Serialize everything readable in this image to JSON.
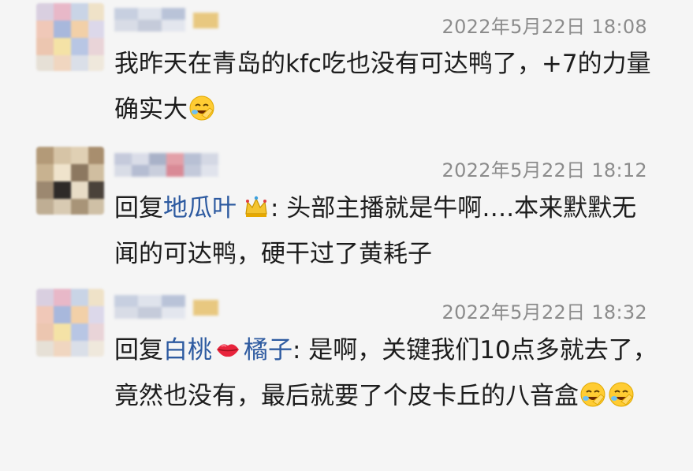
{
  "comments": [
    {
      "timestamp": "2022年5月22日 18:08",
      "text": "我昨天在青岛的kfc吃也没有可达鸭了，+7的力量确实大",
      "emoji_after": "facepalm-laugh-emoji"
    },
    {
      "timestamp": "2022年5月22日 18:12",
      "reply_prefix": "回复",
      "reply_to": "地瓜叶",
      "badge_icon": "crown-icon",
      "text": ": 头部主播就是牛啊….本来默默无闻的可达鸭，硬干过了黄耗子"
    },
    {
      "timestamp": "2022年5月22日 18:32",
      "reply_prefix": "回复",
      "reply_to_part1": "白桃",
      "name_emoji": "lips-icon",
      "reply_to_part2": "橘子",
      "text": ": 是啊，关键我们10点多就去了，竟然也没有，最后就要了个皮卡丘的八音盒",
      "emoji_after": [
        "facepalm-laugh-emoji",
        "facepalm-laugh-emoji"
      ]
    }
  ],
  "colors": {
    "background": "#f5f5f5",
    "timestamp": "#8c8c8c",
    "reply_name": "#2d5aa0",
    "text": "#1c1c1c"
  }
}
